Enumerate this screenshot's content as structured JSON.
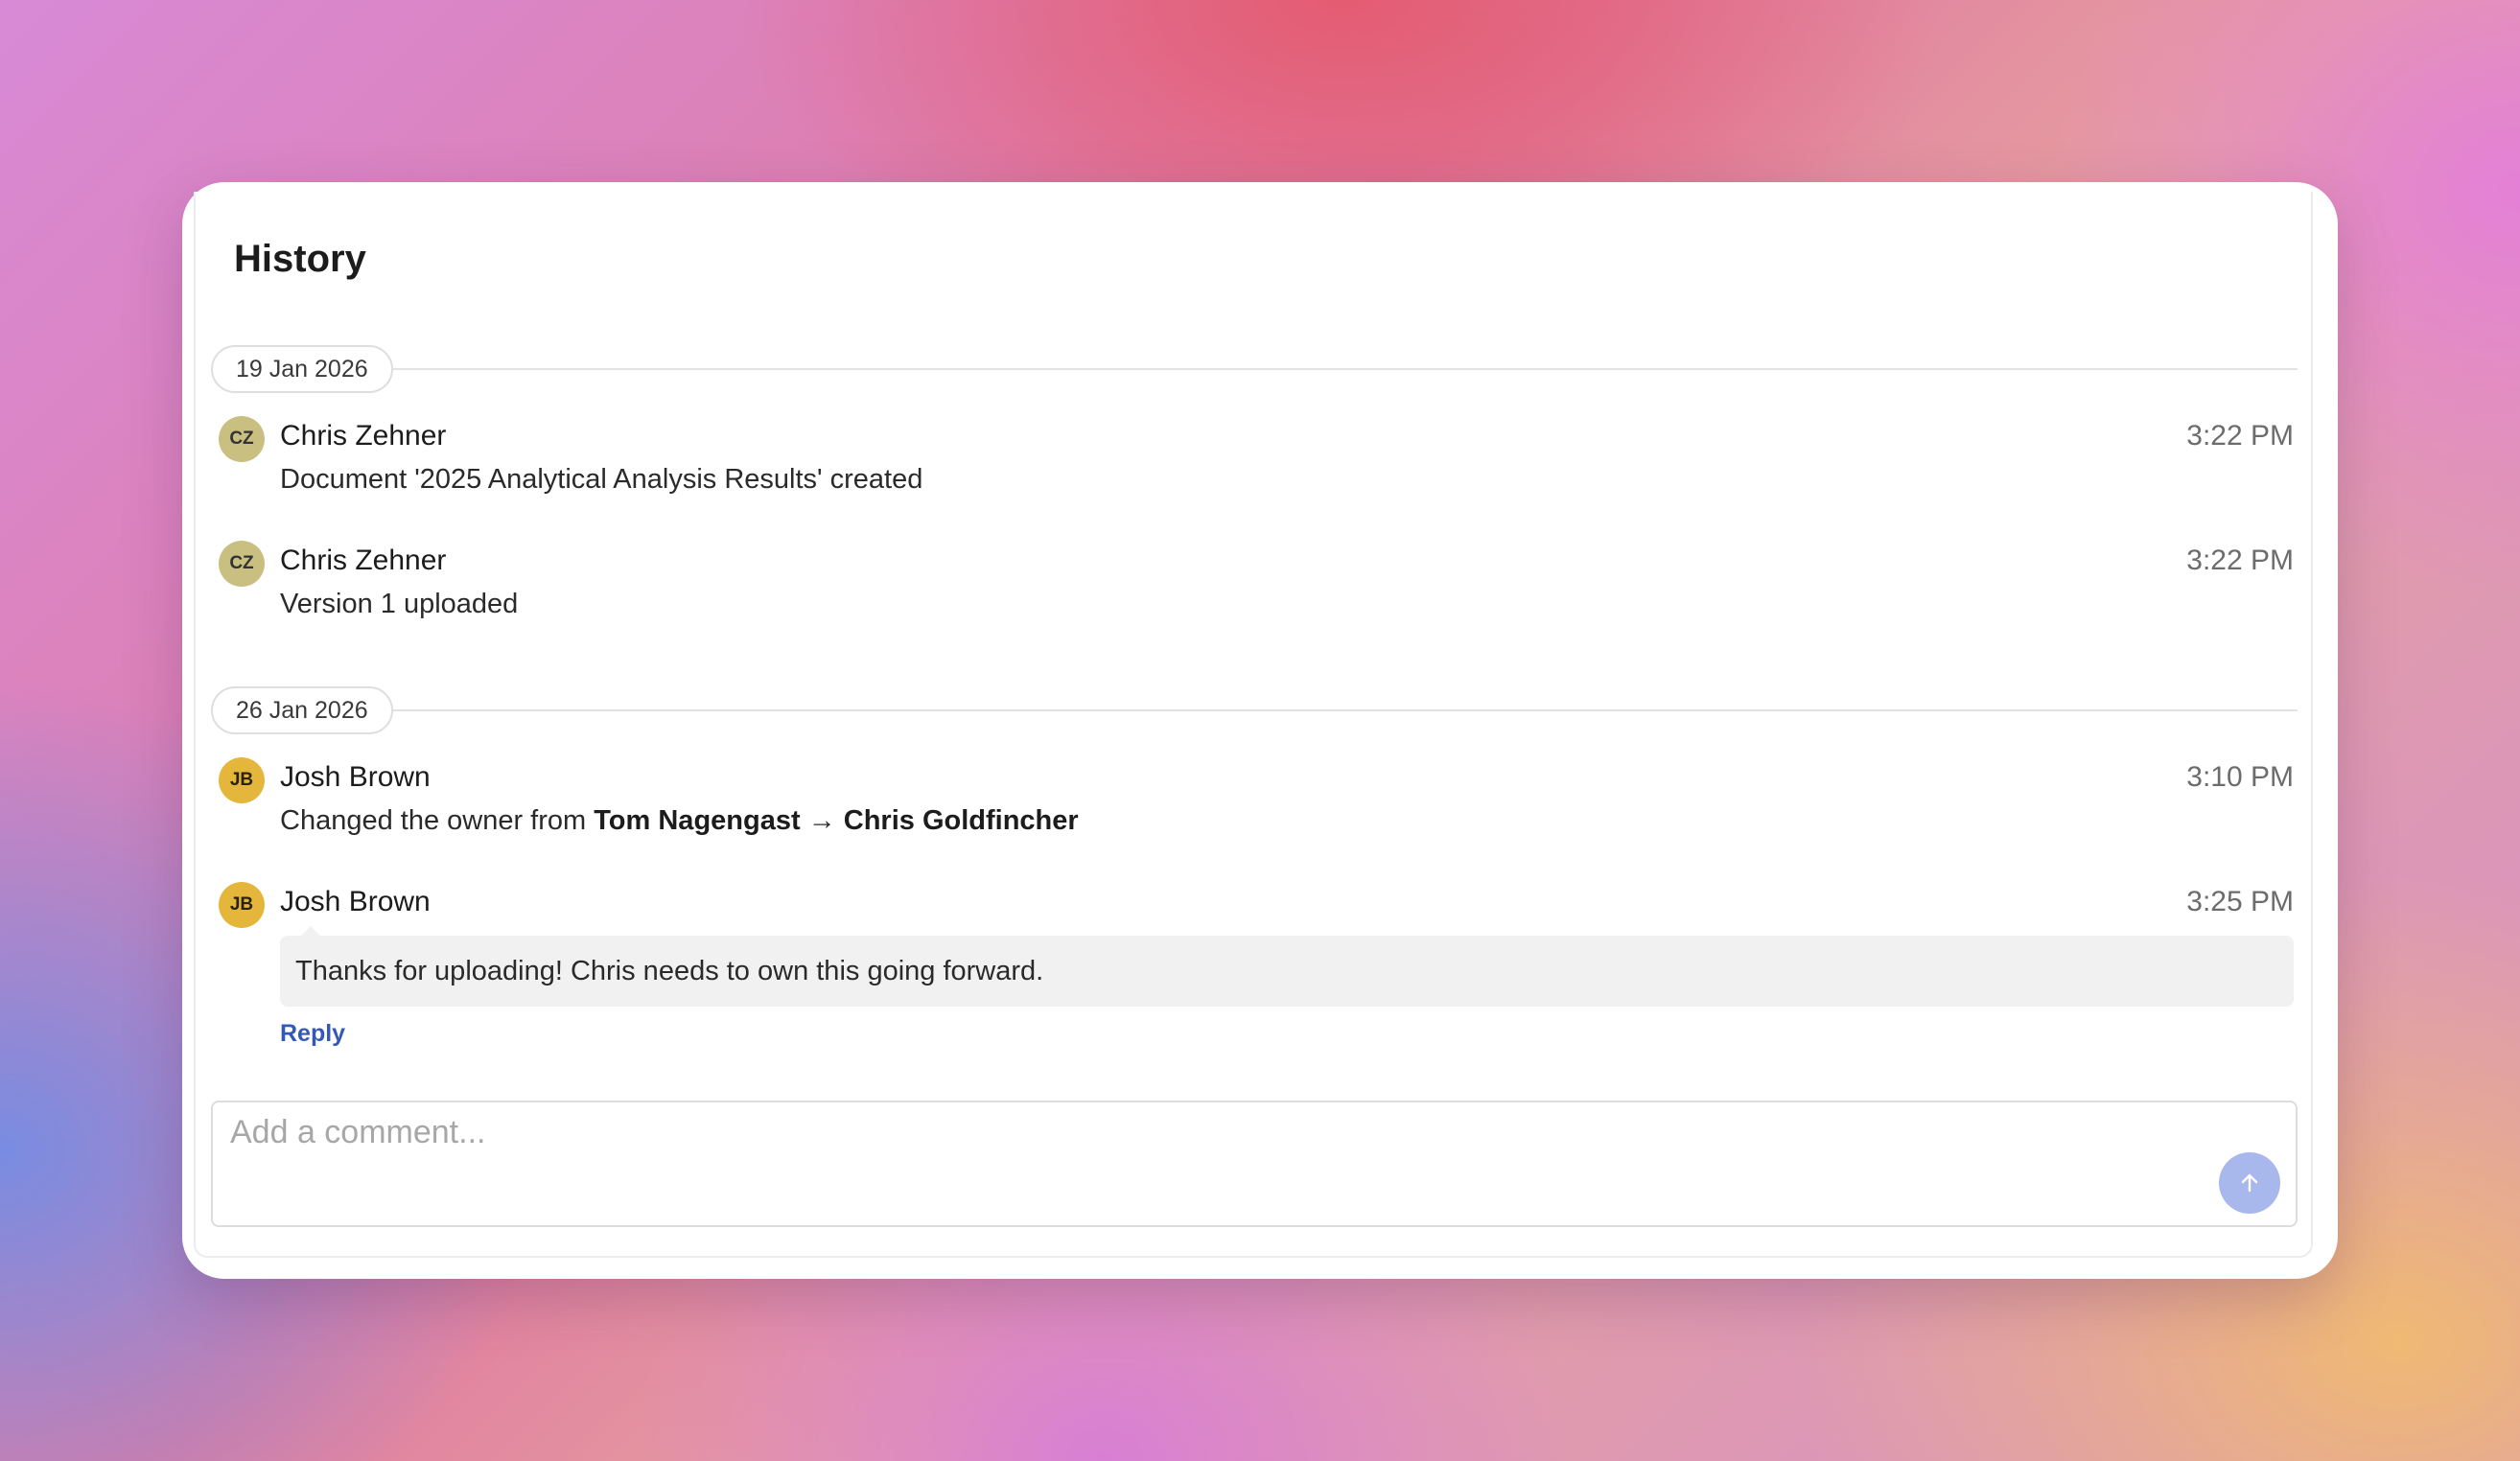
{
  "panel": {
    "title": "History"
  },
  "groups": [
    {
      "date": "19 Jan 2026",
      "entries": [
        {
          "initials": "CZ",
          "name": "Chris Zehner",
          "time": "3:22 PM",
          "text": "Document '2025 Analytical Analysis Results' created"
        },
        {
          "initials": "CZ",
          "name": "Chris Zehner",
          "time": "3:22 PM",
          "text": "Version 1 uploaded"
        }
      ]
    },
    {
      "date": "26 Jan 2026",
      "entries": [
        {
          "initials": "JB",
          "name": "Josh Brown",
          "time": "3:10 PM",
          "text_prefix": "Changed the owner from ",
          "from_owner": "Tom Nagengast",
          "arrow": " → ",
          "to_owner": "Chris Goldfincher"
        },
        {
          "initials": "JB",
          "name": "Josh Brown",
          "time": "3:25 PM",
          "comment": "Thanks for uploading! Chris needs to own this going forward.",
          "reply_label": "Reply"
        }
      ]
    }
  ],
  "composer": {
    "placeholder": "Add a comment...",
    "send_icon": "arrow-up-icon"
  },
  "colors": {
    "accent": "#3358b8",
    "send_button": "#a9b8ec",
    "avatar_cz": "#c8bf80",
    "avatar_jb": "#e5b63c"
  }
}
